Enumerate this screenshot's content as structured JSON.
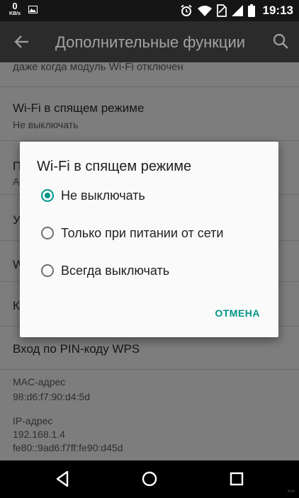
{
  "status_bar": {
    "net_speed_value": "0",
    "net_speed_unit": "KB/s",
    "time": "19:13"
  },
  "app_bar": {
    "title": "Дополнительные функции"
  },
  "settings_list": {
    "partial_top_text": "даже когда модуль Wi-Fi отключен",
    "wifi_sleep": {
      "title": "Wi-Fi в спящем режиме",
      "summary": "Не выключать"
    },
    "hidden_rows_initials": [
      "П",
      "У",
      "W",
      "К"
    ],
    "hidden_row_subtitle_initial": "А",
    "wps_pin": {
      "title": "Вход по PIN-коду WPS"
    },
    "mac": {
      "title": "MAC-адрес",
      "value": "98:d6:f7:90:d4:5d"
    },
    "ip": {
      "title": "IP-адрес",
      "value_v4": "192.168.1.4",
      "value_v6": "fe80::9ad6:f7ff:fe90:d45d"
    }
  },
  "dialog": {
    "title": "Wi-Fi в спящем режиме",
    "options": [
      {
        "label": "Не выключать",
        "selected": true
      },
      {
        "label": "Только при питании от сети",
        "selected": false
      },
      {
        "label": "Всегда выключать",
        "selected": false
      }
    ],
    "cancel_label": "ОТМЕНА"
  },
  "watermark": "***",
  "colors": {
    "accent": "#009688",
    "dialog_bg": "#fafafa",
    "app_bar_bg": "#2b2b2b"
  },
  "icons": {
    "status": [
      "image-icon",
      "alarm-icon",
      "wifi-icon",
      "no-sim-icon",
      "signal-icon",
      "battery-icon"
    ],
    "app_bar": [
      "back-arrow-icon",
      "search-icon"
    ],
    "nav": [
      "nav-back-icon",
      "nav-home-icon",
      "nav-recents-icon"
    ]
  }
}
